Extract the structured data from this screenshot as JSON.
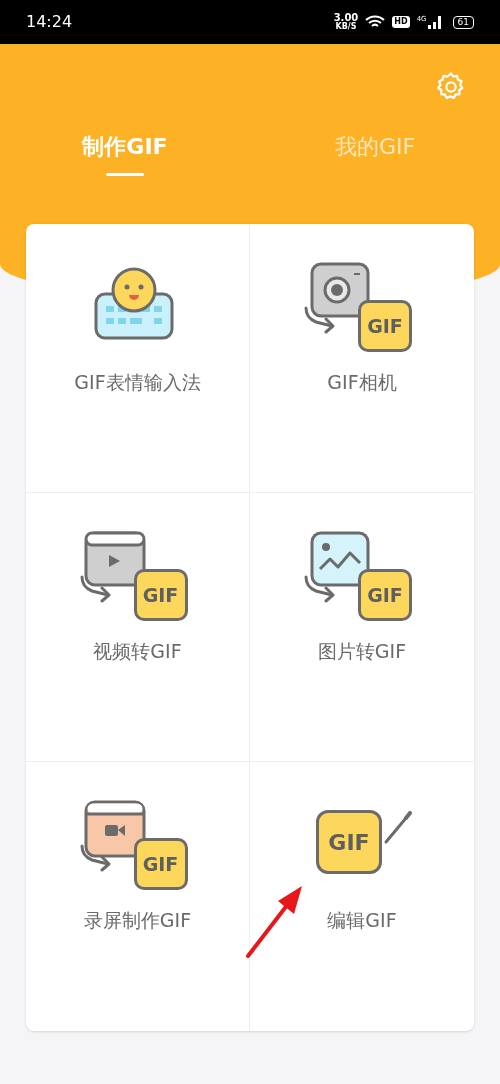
{
  "status_bar": {
    "time": "14:24",
    "speed": "3.00",
    "speed_unit": "KB/S",
    "hd": "HD",
    "network": "4G",
    "battery": "61"
  },
  "tabs": [
    {
      "label": "制作GIF",
      "selected": true
    },
    {
      "label": "我的GIF",
      "selected": false
    }
  ],
  "tile_rows": [
    {
      "tiles": [
        {
          "kind": "keyboard",
          "label": "GIF表情输入法",
          "pointed": false
        },
        {
          "kind": "camera",
          "label": "GIF相机",
          "badge": "GIF",
          "pointed": false
        }
      ]
    },
    {
      "tiles": [
        {
          "kind": "video",
          "label": "视频转GIF",
          "badge": "GIF",
          "pointed": false
        },
        {
          "kind": "image",
          "label": "图片转GIF",
          "badge": "GIF",
          "pointed": false
        }
      ]
    },
    {
      "tiles": [
        {
          "kind": "screen",
          "label": "录屏制作GIF",
          "badge": "GIF",
          "pointed": false
        },
        {
          "kind": "edit",
          "label": "编辑GIF",
          "badge": "GIF",
          "pointed": true
        }
      ]
    }
  ]
}
